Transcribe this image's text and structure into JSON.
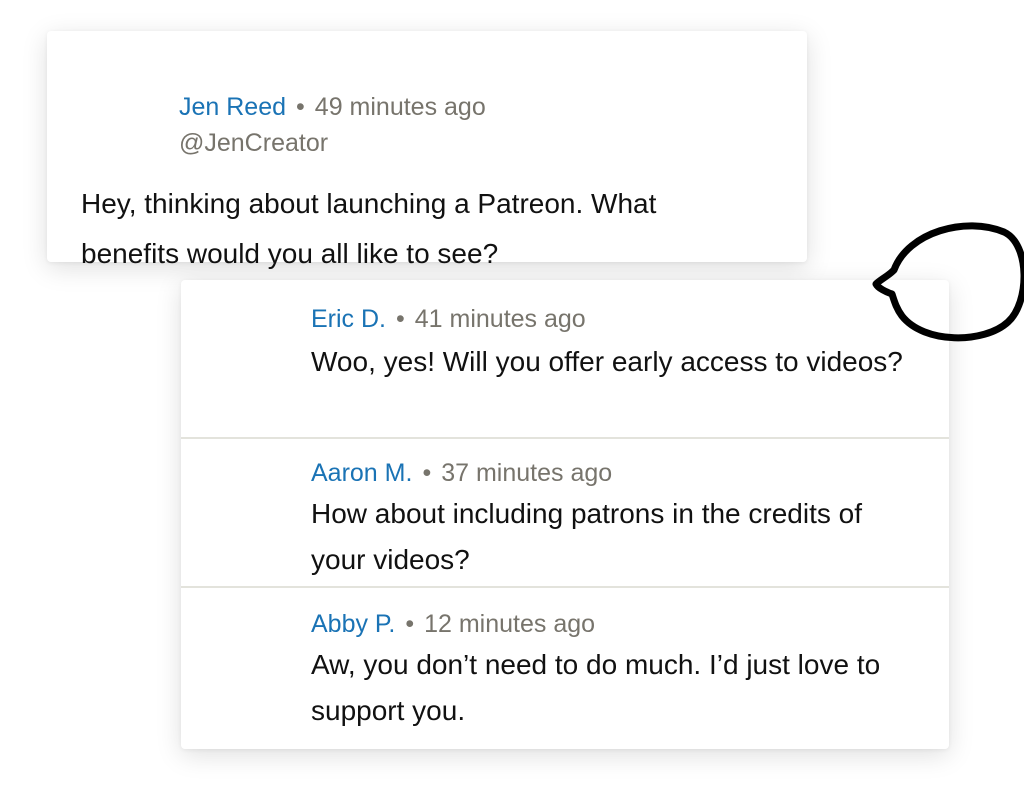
{
  "colors": {
    "accent": "#1a73b5",
    "muted": "#77746c",
    "text": "#111111"
  },
  "post": {
    "author": "Jen Reed",
    "separator": "•",
    "time": "49 minutes ago",
    "handle": "@JenCreator",
    "body": "Hey, thinking about launching a Patreon. What benefits would you all like to see?"
  },
  "replies": [
    {
      "author": "Eric D.",
      "separator": "•",
      "time": "41 minutes ago",
      "body": "Woo, yes! Will you offer early access to videos?"
    },
    {
      "author": "Aaron M.",
      "separator": "•",
      "time": "37 minutes ago",
      "body": "How about including patrons in the credits of your videos?"
    },
    {
      "author": "Abby P.",
      "separator": "•",
      "time": "12 minutes ago",
      "body": "Aw, you don’t need to do much. I’d just love to support you."
    }
  ],
  "icons": {
    "decoration": "speech-bubble-icon"
  }
}
